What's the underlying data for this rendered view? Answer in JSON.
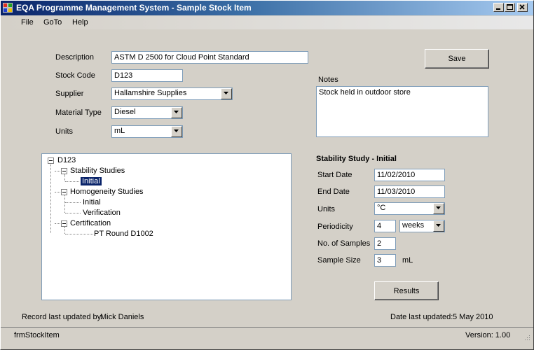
{
  "window": {
    "title": "EQA Programme Management System - Sample Stock Item",
    "controls": [
      "_",
      "□",
      "X"
    ]
  },
  "menu": {
    "items": [
      "File",
      "GoTo",
      "Help"
    ]
  },
  "form": {
    "description_label": "Description",
    "description_value": "ASTM D 2500 for Cloud Point Standard",
    "stock_code_label": "Stock Code",
    "stock_code_value": "D123",
    "supplier_label": "Supplier",
    "supplier_value": "Hallamshire Supplies",
    "material_type_label": "Material Type",
    "material_type_value": "Diesel",
    "units_label": "Units",
    "units_value": "mL",
    "save_label": "Save",
    "notes_label": "Notes",
    "notes_value": "Stock held in outdoor store"
  },
  "tree": {
    "root": "D123",
    "stability": "Stability Studies",
    "stability_initial": "Initial",
    "homogeneity": "Homogeneity Studies",
    "homogeneity_initial": "Initial",
    "homogeneity_verification": "Verification",
    "certification": "Certification",
    "certification_round": "PT Round D1002"
  },
  "study": {
    "title": "Stability Study - Initial",
    "start_date_label": "Start Date",
    "start_date_value": "11/02/2010",
    "end_date_label": "End Date",
    "end_date_value": "11/03/2010",
    "units_label": "Units",
    "units_value": "°C",
    "periodicity_label": "Periodicity",
    "periodicity_value": "4",
    "periodicity_unit": "weeks",
    "samples_label": "No. of Samples",
    "samples_value": "2",
    "sample_size_label": "Sample Size",
    "sample_size_value": "3",
    "sample_size_unit": "mL",
    "results_label": "Results"
  },
  "footer": {
    "record_updated_label": "Record last updated by:",
    "record_updated_value": "Mick Daniels",
    "date_updated_label": "Date last updated:",
    "date_updated_value": "5 May 2010"
  },
  "status": {
    "form_name": "frmStockItem",
    "version": "Version: 1.00"
  },
  "colors": {
    "titlebar_start": "#0a246a",
    "selection": "#0a246a",
    "face": "#d4d0c8"
  }
}
